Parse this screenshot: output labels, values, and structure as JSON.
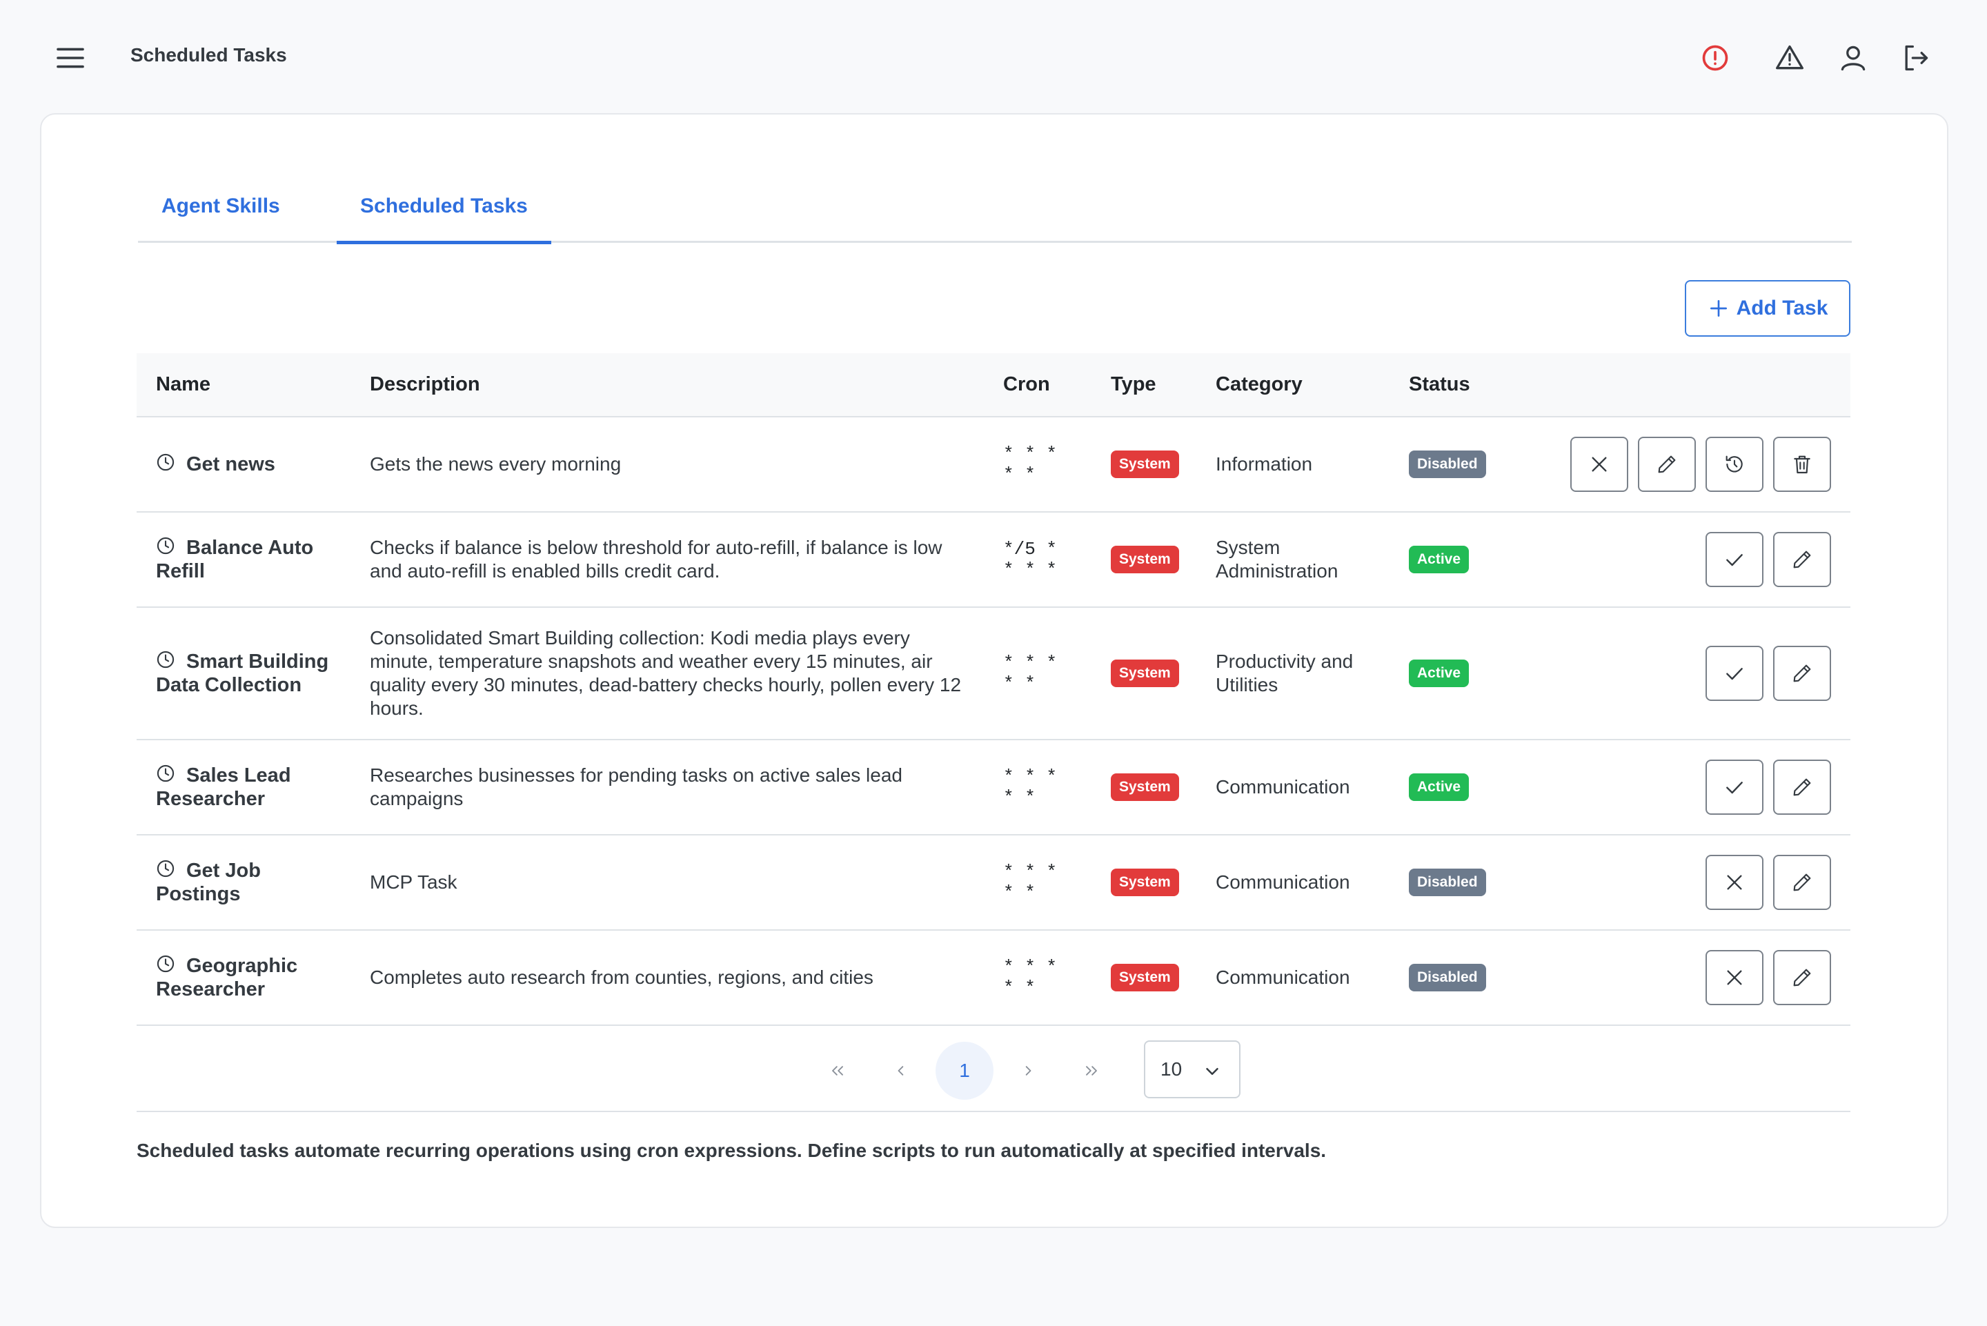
{
  "header": {
    "title": "Scheduled Tasks",
    "icons": [
      "menu-icon",
      "alert-circle-icon",
      "warning-triangle-icon",
      "user-icon",
      "logout-icon"
    ],
    "alert_color": "#e23b3b"
  },
  "tabs": [
    {
      "label": "Agent Skills",
      "active": false
    },
    {
      "label": "Scheduled Tasks",
      "active": true
    }
  ],
  "toolbar": {
    "add_label": "Add Task"
  },
  "table": {
    "columns": [
      "Name",
      "Description",
      "Cron",
      "Type",
      "Category",
      "Status"
    ],
    "rows": [
      {
        "name": "Get news",
        "description": "Gets the news every morning",
        "cron": "* * *\n* *",
        "type": "System",
        "category": "Information",
        "status": "Disabled",
        "actions": [
          "close",
          "edit",
          "history",
          "delete"
        ]
      },
      {
        "name": "Balance Auto Refill",
        "description": "Checks if balance is below threshold for auto-refill, if balance is low and auto-refill is enabled bills credit card.",
        "cron": "*/5 *\n* * *",
        "type": "System",
        "category": "System Administration",
        "status": "Active",
        "actions": [
          "check",
          "edit"
        ]
      },
      {
        "name": "Smart Building Data Collection",
        "description": "Consolidated Smart Building collection: Kodi media plays every minute, temperature snapshots and weather every 15 minutes, air quality every 30 minutes, dead-battery checks hourly, pollen every 12 hours.",
        "cron": "* * *\n* *",
        "type": "System",
        "category": "Productivity and Utilities",
        "status": "Active",
        "actions": [
          "check",
          "edit"
        ]
      },
      {
        "name": "Sales Lead Researcher",
        "description": "Researches businesses for pending tasks on active sales lead campaigns",
        "cron": "* * *\n* *",
        "type": "System",
        "category": "Communication",
        "status": "Active",
        "actions": [
          "check",
          "edit"
        ]
      },
      {
        "name": "Get Job Postings",
        "description": "MCP Task",
        "cron": "* * *\n* *",
        "type": "System",
        "category": "Communication",
        "status": "Disabled",
        "actions": [
          "close",
          "edit"
        ]
      },
      {
        "name": "Geographic Researcher",
        "description": "Completes auto research from counties, regions, and cities",
        "cron": "* * *\n* *",
        "type": "System",
        "category": "Communication",
        "status": "Disabled",
        "actions": [
          "close",
          "edit"
        ]
      }
    ]
  },
  "pagination": {
    "current_page": "1",
    "page_size": "10"
  },
  "footnote": "Scheduled tasks automate recurring operations using cron expressions. Define scripts to run automatically at specified intervals.",
  "colors": {
    "accent": "#2f6fde",
    "system": "#e23b3b",
    "active": "#22bb55",
    "disabled": "#6c7a8c"
  }
}
